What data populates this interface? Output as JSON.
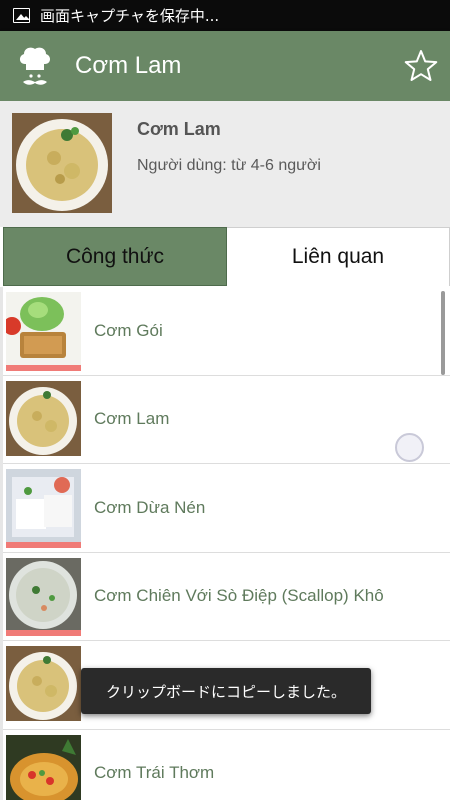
{
  "status_bar": {
    "notification_text": "画面キャプチャを保存中..."
  },
  "app_bar": {
    "title": "Cơm Lam",
    "logo_icon": "chef-icon",
    "favorite_icon": "star-outline-icon"
  },
  "header": {
    "dish_name": "Cơm Lam",
    "serving": "Người dùng: từ 4-6 người"
  },
  "tabs": [
    {
      "label": "Công thức",
      "active": true
    },
    {
      "label": "Liên quan",
      "active": false
    }
  ],
  "related_list": [
    {
      "name": "Cơm Gói",
      "image": "rice-wrap-photo",
      "accent": true
    },
    {
      "name": "Cơm Lam",
      "image": "fried-rice-photo",
      "accent": false
    },
    {
      "name": "Cơm Dừa Nén",
      "image": "coconut-rice-photo",
      "accent": true
    },
    {
      "name": "Cơm Chiên Với Sò Điệp (Scallop) Khô",
      "image": "scallop-rice-photo",
      "accent": true
    },
    {
      "name": "",
      "image": "fried-rice-photo",
      "accent": false
    },
    {
      "name": "Cơm Trái Thơm",
      "image": "pineapple-rice-photo",
      "accent": false
    }
  ],
  "toast": {
    "message": "クリップボードにコピーしました。"
  },
  "colors": {
    "primary": "#6a8866",
    "accent": "#f07b77",
    "list_text": "#5f7a5c"
  }
}
